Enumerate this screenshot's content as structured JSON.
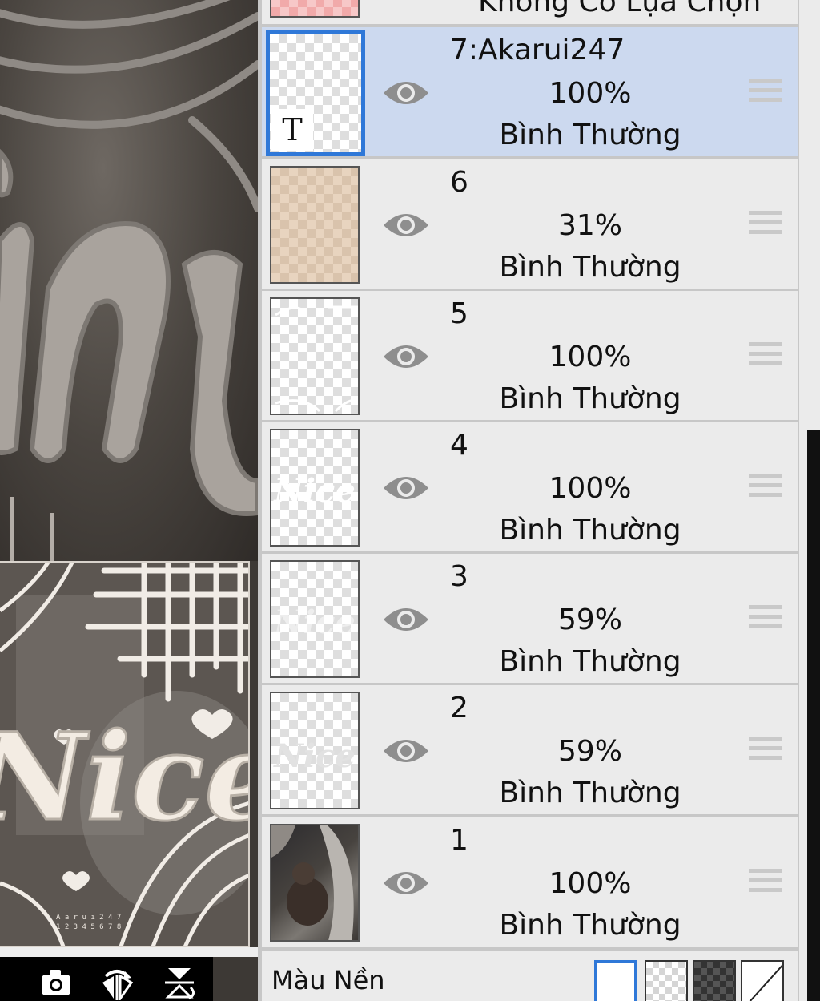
{
  "canvas": {
    "artwork_text": "Nice",
    "toolbar": [
      {
        "name": "layer-action-icon"
      },
      {
        "name": "camera-icon"
      },
      {
        "name": "flip-horizontal-icon"
      },
      {
        "name": "flip-vertical-icon"
      }
    ]
  },
  "layers_panel": {
    "partial_top_label": "Không Có Lựa Chọn",
    "layers": [
      {
        "name": "7:Akarui247",
        "opacity": "100%",
        "mode": "Bình Thường",
        "selected": true,
        "thumb": "text"
      },
      {
        "name": "6",
        "opacity": "31%",
        "mode": "Bình Thường",
        "selected": false,
        "thumb": "tan"
      },
      {
        "name": "5",
        "opacity": "100%",
        "mode": "Bình Thường",
        "selected": false,
        "thumb": "transparent"
      },
      {
        "name": "4",
        "opacity": "100%",
        "mode": "Bình Thường",
        "selected": false,
        "thumb": "nice"
      },
      {
        "name": "3",
        "opacity": "59%",
        "mode": "Bình Thường",
        "selected": false,
        "thumb": "transparent"
      },
      {
        "name": "2",
        "opacity": "59%",
        "mode": "Bình Thường",
        "selected": false,
        "thumb": "nice-faint"
      },
      {
        "name": "1",
        "opacity": "100%",
        "mode": "Bình Thường",
        "selected": false,
        "thumb": "photo"
      }
    ],
    "background": {
      "label": "Màu Nền",
      "swatches": [
        "white",
        "transparent-light",
        "transparent-dark",
        "none"
      ],
      "selected": "white"
    }
  },
  "colors": {
    "selected_row": "#ccd9ef",
    "selected_border": "#2f78d8",
    "row_bg": "#ebebeb"
  }
}
